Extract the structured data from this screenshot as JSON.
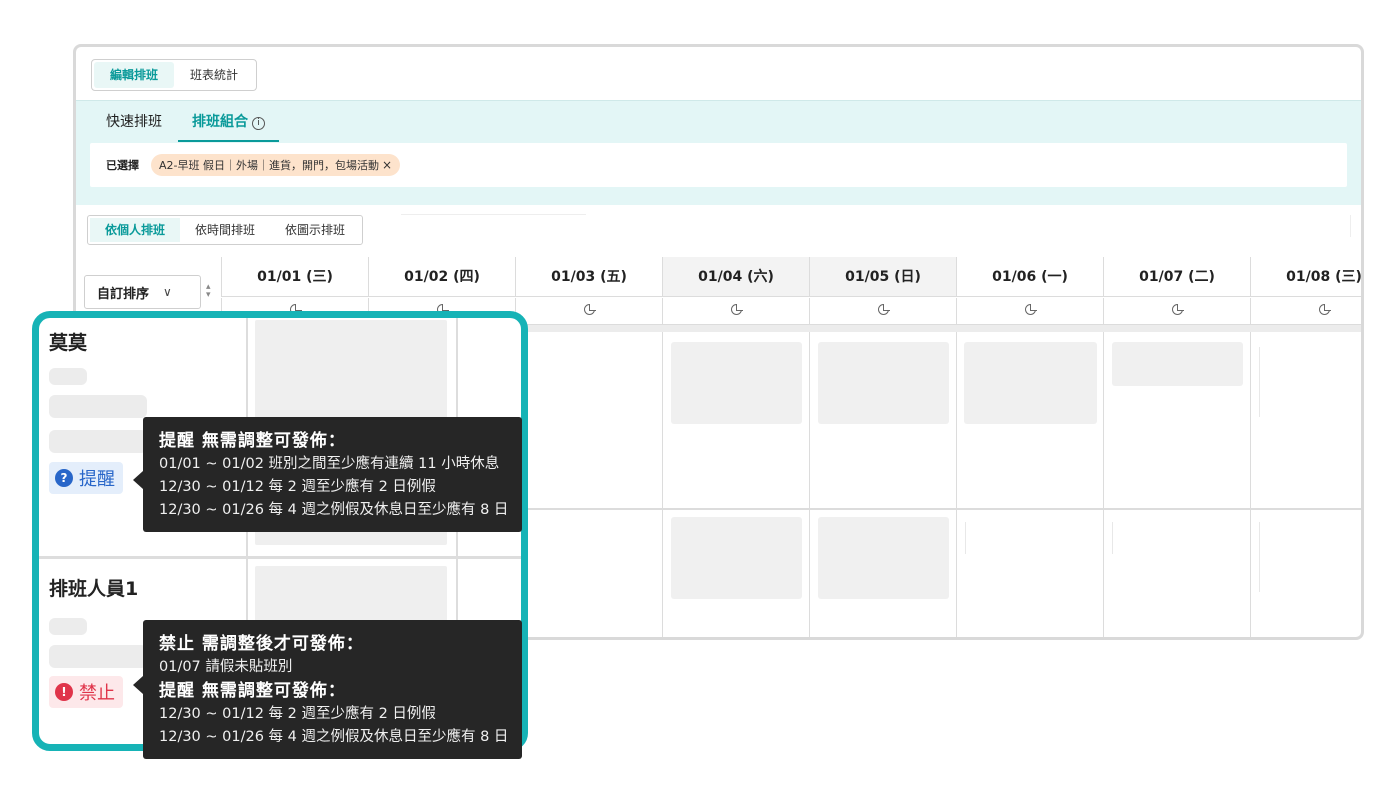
{
  "mode_tabs": [
    "編輯排班",
    "班表統計"
  ],
  "sub_tabs": {
    "quick": "快速排班",
    "combo": "排班組合",
    "info_glyph": "i"
  },
  "selected": {
    "label": "已選擇",
    "chip": "A2-早班 假日｜外場｜進貨，開門，包場活動",
    "remove_glyph": "×"
  },
  "view_tabs": [
    "依個人排班",
    "依時間排班",
    "依圖示排班"
  ],
  "sort": {
    "label": "自訂排序",
    "chevron": "∨",
    "arrows": "⇅"
  },
  "days": [
    "01/01 (三)",
    "01/02 (四)",
    "01/03 (五)",
    "01/04 (六)",
    "01/05 (日)",
    "01/06 (一)",
    "01/07 (二)",
    "01/08 (三)"
  ],
  "weekend_days": [
    "01/04 (六)",
    "01/05 (日)"
  ],
  "people": [
    {
      "name": "莫莫",
      "badge": "提醒",
      "badge_type": "warn",
      "badge_glyph": "?"
    },
    {
      "name": "排班人員1",
      "badge": "禁止",
      "badge_type": "ban",
      "badge_glyph": "!"
    }
  ],
  "tooltip1": {
    "title": "提醒 無需調整可發佈：",
    "lines": [
      "01/01 ~ 01/02 班別之間至少應有連續 11 小時休息",
      "12/30 ~ 01/12 每 2 週至少應有 2 日例假",
      "12/30 ~ 01/26 每 4 週之例假及休息日至少應有 8 日"
    ]
  },
  "tooltip2": {
    "title1": "禁止 需調整後才可發佈：",
    "line1": "01/07 請假未貼班別",
    "title2": "提醒 無需調整可發佈：",
    "lines": [
      "12/30 ~ 01/12 每 2 週至少應有 2 日例假",
      "12/30 ~ 01/26 每 4 週之例假及休息日至少應有 8 日"
    ]
  },
  "colors": {
    "accent": "#16b3b6",
    "accent_text": "#0a9a9a",
    "panel_bg": "#e3f6f6",
    "warn": "#2866c9",
    "ban": "#e0344a",
    "chip_bg": "#fde3cc"
  },
  "icons": [
    "info-icon",
    "close-icon",
    "chevron-down-icon",
    "sort-icon",
    "stats-icon",
    "question-icon",
    "exclamation-icon"
  ]
}
